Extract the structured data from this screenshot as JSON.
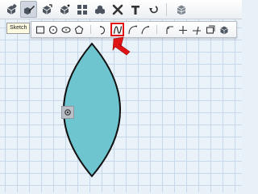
{
  "toolbar": {
    "tools": [
      {
        "name": "smart-primitives",
        "icon": "cube-with-gem-icon"
      },
      {
        "name": "sketch",
        "icon": "pencil-cube-icon",
        "active": true
      },
      {
        "name": "construct",
        "icon": "cube-arrow-icon"
      },
      {
        "name": "modify",
        "icon": "cube-sparkle-icon"
      },
      {
        "name": "pattern",
        "icon": "cube-grid-icon"
      },
      {
        "name": "group",
        "icon": "cubes-icon"
      },
      {
        "name": "combine",
        "icon": "cross-icon"
      },
      {
        "name": "text",
        "icon": "text-t-icon"
      },
      {
        "name": "measure",
        "icon": "hook-arrow-icon"
      },
      {
        "name": "material",
        "icon": "stacked-cube-icon"
      }
    ],
    "tooltip": "Sketch"
  },
  "sketch_toolbar": {
    "groups": [
      [
        "rectangle-icon",
        "circle-icon",
        "ellipse-icon",
        "polygon-icon"
      ],
      [
        "arc-icon",
        "spline-icon",
        "curve-icon",
        "open-arc-icon"
      ],
      [
        "fillet-icon",
        "trim-icon",
        "extend-icon",
        "offset-icon",
        "project-icon"
      ]
    ],
    "highlighted": "spline-icon"
  },
  "colors": {
    "shape_fill": "#6ec5d0",
    "shape_stroke": "#111111",
    "highlight": "#e01414",
    "arrow": "#e01414"
  }
}
